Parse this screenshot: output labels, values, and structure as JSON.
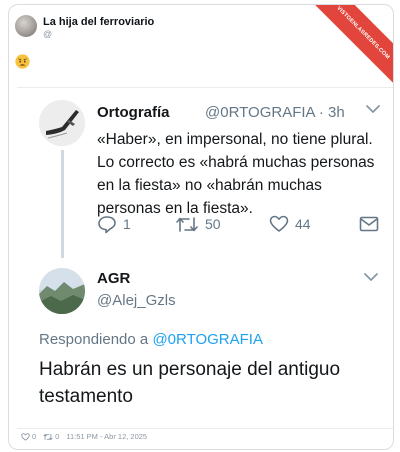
{
  "post": {
    "author_name": "La hija del ferroviario",
    "author_handle": "@",
    "reaction_icon": "worried-face-emoji",
    "badge_text": "VISTOENLASREDES.COM"
  },
  "tweet1": {
    "name": "Ortografía",
    "handle": "@0RTOGRAFIA · 3h",
    "body": "«Haber», en impersonal, no tiene plural. Lo correcto es «habrá muchas personas en la fiesta» no «habrán muchas personas en la fiesta».",
    "replies": "1",
    "retweets": "50",
    "likes": "44"
  },
  "tweet2": {
    "name": "AGR",
    "handle": "@Alej_Gzls",
    "reply_prefix": "Respondiendo a ",
    "reply_mention": "@0RTOGRAFIA",
    "body": "Habrán es un personaje del antiguo testamento"
  },
  "footer": {
    "likes": "0",
    "reposts": "0",
    "timestamp": "11:51 PM - Abr 12, 2025"
  },
  "colors": {
    "link_blue": "#1da1f2",
    "muted_gray": "#657786",
    "badge_red": "#e2453c"
  }
}
